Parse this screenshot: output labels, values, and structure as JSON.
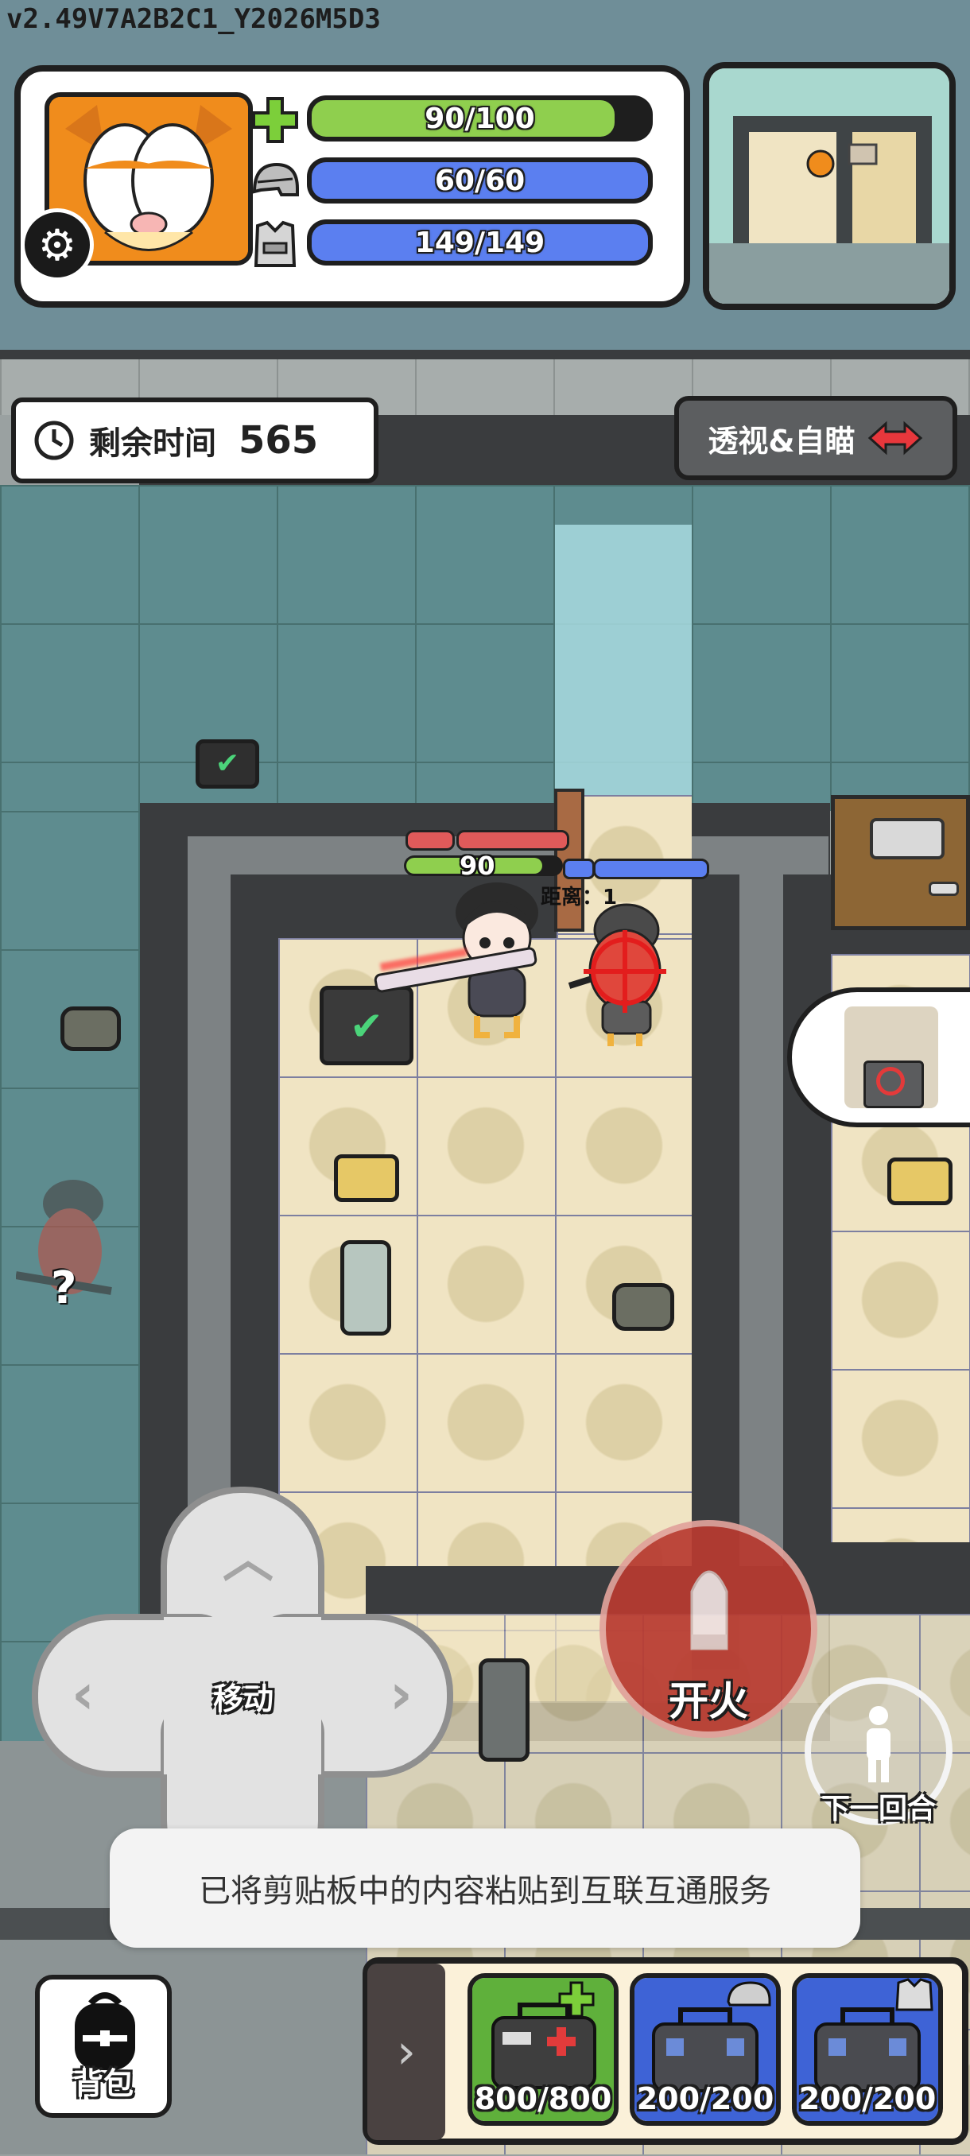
{
  "version": "v2.49V7A2B2C1_Y2026M5D3",
  "player": {
    "health": {
      "label": "90/100",
      "fraction": 0.9,
      "color": "#8fcf4e",
      "icon": "green-cross-icon"
    },
    "helmet": {
      "label": "60/60",
      "fraction": 1.0,
      "color": "#5b7ff0",
      "icon": "helmet-icon"
    },
    "armor": {
      "label": "149/149",
      "fraction": 1.0,
      "color": "#5b7ff0",
      "icon": "armor-vest-icon"
    }
  },
  "hud": {
    "timer_label": "剩余时间",
    "timer_value": "565",
    "xray_label": "透视&自瞄"
  },
  "world": {
    "player_hp_number": "90",
    "distance_label": "距离：1",
    "unknown_marker": "?"
  },
  "controls": {
    "move_label": "移动",
    "fire_label": "开火",
    "next_turn_label": "下一回合",
    "backpack_label": "背包"
  },
  "toast": "已将剪贴板中的内容粘贴到互联互通服务",
  "kits": [
    {
      "label": "800/800",
      "type": "medkit",
      "bg": "#5fb03b",
      "badge": "green-cross-icon"
    },
    {
      "label": "200/200",
      "type": "helmet-repair",
      "bg": "#3e63d6",
      "badge": "helmet-icon"
    },
    {
      "label": "200/200",
      "type": "armor-repair",
      "bg": "#3e63d6",
      "badge": "armor-vest-icon"
    }
  ],
  "colors": {
    "accent_red": "#b83a30",
    "health_green": "#8fcf4e",
    "shield_blue": "#5b7ff0"
  }
}
